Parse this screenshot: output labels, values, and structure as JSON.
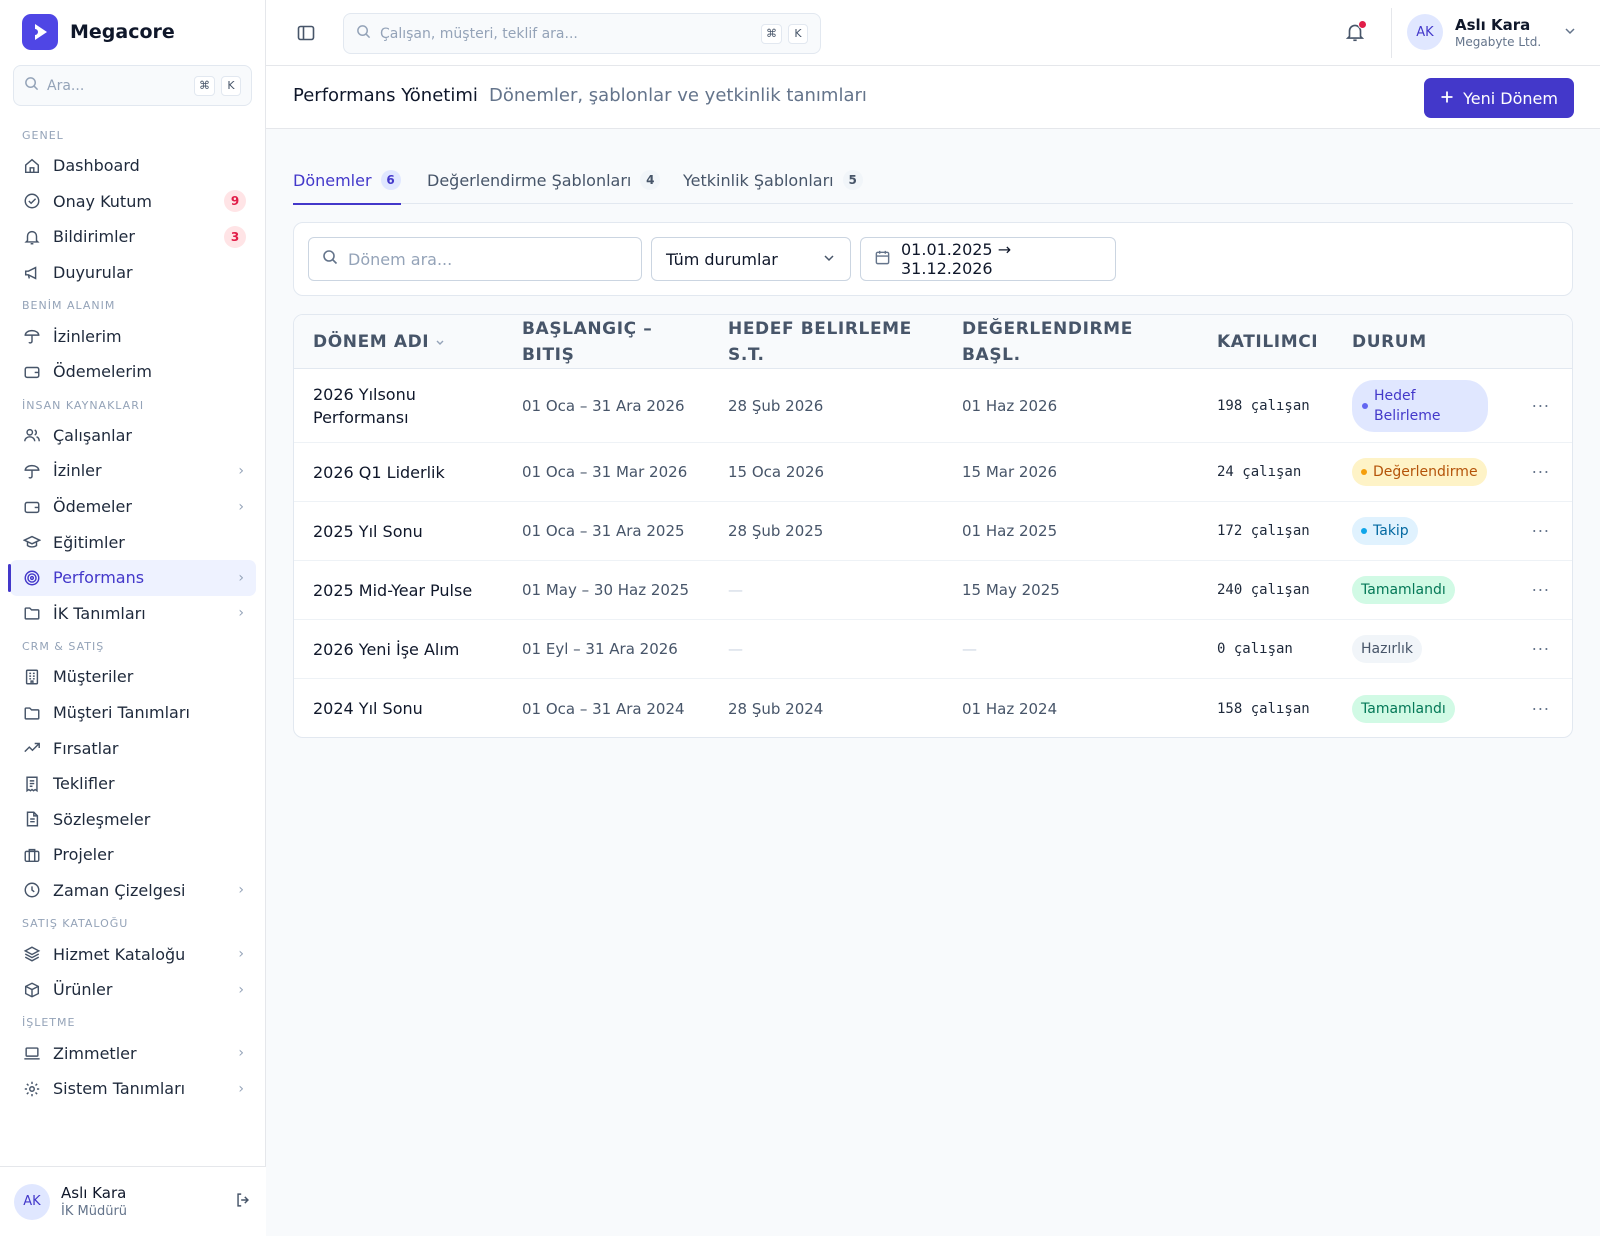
{
  "app": {
    "name": "Megacore"
  },
  "sidebar_search": {
    "placeholder": "Ara...",
    "kbd1": "⌘",
    "kbd2": "K"
  },
  "sections": {
    "genel": "GENEL",
    "benim": "BENİM ALANIM",
    "ik": "İNSAN KAYNAKLARI",
    "crm": "CRM & SATIŞ",
    "katalog": "SATIŞ KATALOĞU",
    "isletme": "İŞLETME"
  },
  "nav": {
    "dashboard": "Dashboard",
    "onay": "Onay Kutum",
    "onay_badge": "9",
    "bildirim": "Bildirimler",
    "bildirim_badge": "3",
    "duyurular": "Duyurular",
    "izinlerim": "İzinlerim",
    "odemelerim": "Ödemelerim",
    "calisanlar": "Çalışanlar",
    "izinler": "İzinler",
    "odemeler": "Ödemeler",
    "egitimler": "Eğitimler",
    "performans": "Performans",
    "ik_tanimlari": "İK Tanımları",
    "musteriler": "Müşteriler",
    "musteri_tanimlari": "Müşteri Tanımları",
    "firsatlar": "Fırsatlar",
    "teklifler": "Teklifler",
    "sozlesmeler": "Sözleşmeler",
    "projeler": "Projeler",
    "zaman": "Zaman Çizelgesi",
    "hizmet": "Hizmet Kataloğu",
    "urunler": "Ürünler",
    "zimmetler": "Zimmetler",
    "sistem": "Sistem Tanımları"
  },
  "user": {
    "initials": "AK",
    "name": "Aslı Kara",
    "role": "İK Müdürü",
    "company": "Megabyte Ltd."
  },
  "top_search": {
    "placeholder": "Çalışan, müşteri, teklif ara...",
    "kbd1": "⌘",
    "kbd2": "K"
  },
  "header": {
    "title": "Performans Yönetimi",
    "subtitle": "Dönemler, şablonlar ve yetkinlik tanımları",
    "new_button": "Yeni Dönem"
  },
  "tabs": [
    {
      "label": "Dönemler",
      "count": "6"
    },
    {
      "label": "Değerlendirme Şablonları",
      "count": "4"
    },
    {
      "label": "Yetkinlik Şablonları",
      "count": "5"
    }
  ],
  "filters": {
    "search_placeholder": "Dönem ara...",
    "status_value": "Tüm durumlar",
    "date_range": "01.01.2025 → 31.12.2026"
  },
  "table": {
    "headers": {
      "name": "DÖNEM ADI",
      "range_l1": "BAŞLANGIÇ –",
      "range_l2": "BITIŞ",
      "goal_l1": "HEDEF BELIRLEME",
      "goal_l2": "S.T.",
      "eval_l1": "DEĞERLENDIRME",
      "eval_l2": "BAŞL.",
      "participants": "KATILIMCI",
      "status": "DURUM"
    },
    "rows": [
      {
        "name_l1": "2026 Yılsonu",
        "name_l2": "Performansı",
        "range": "01 Oca – 31 Ara 2026",
        "goal": "28 Şub 2026",
        "eval": "01 Haz 2026",
        "count": "198 çalışan",
        "status_l1": "Hedef",
        "status_l2": "Belirleme"
      },
      {
        "name": "2026 Q1 Liderlik",
        "range": "01 Oca – 31 Mar 2026",
        "goal": "15 Oca 2026",
        "eval": "15 Mar 2026",
        "count": "24 çalışan",
        "status": "Değerlendirme"
      },
      {
        "name": "2025 Yıl Sonu",
        "range": "01 Oca – 31 Ara 2025",
        "goal": "28 Şub 2025",
        "eval": "01 Haz 2025",
        "count": "172 çalışan",
        "status": "Takip"
      },
      {
        "name": "2025 Mid-Year Pulse",
        "range": "01 May – 30 Haz 2025",
        "goal": "—",
        "eval": "15 May 2025",
        "count": "240 çalışan",
        "status": "Tamamlandı"
      },
      {
        "name": "2026 Yeni İşe Alım",
        "range": "01 Eyl – 31 Ara 2026",
        "goal": "—",
        "eval": "—",
        "count": "0 çalışan",
        "status": "Hazırlık"
      },
      {
        "name": "2024 Yıl Sonu",
        "range": "01 Oca – 31 Ara 2024",
        "goal": "28 Şub 2024",
        "eval": "01 Haz 2024",
        "count": "158 çalışan",
        "status": "Tamamlandı"
      }
    ],
    "more": "···"
  }
}
